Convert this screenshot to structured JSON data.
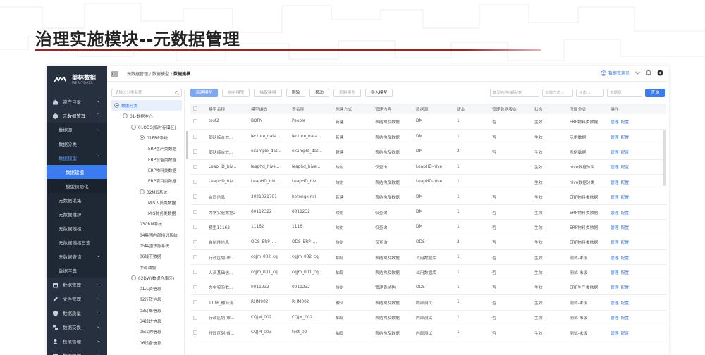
{
  "slide_title": "治理实施模块--元数据管理",
  "logo": {
    "name": "美林数据",
    "sub": "MERITDATA"
  },
  "colors": {
    "accent": "#3b7df0",
    "title_line": "#b01b22",
    "sidebar_bg": "#26303f"
  },
  "sidebar": [
    {
      "label": "资产目录",
      "icon": "home-icon",
      "level": 0,
      "chev": "⌄"
    },
    {
      "label": "元数据管理",
      "icon": "box-icon",
      "level": 0,
      "chev": "⌃",
      "state": "active"
    },
    {
      "label": "数据源",
      "level": 1,
      "chev": "⌄"
    },
    {
      "label": "数据分类",
      "level": 1
    },
    {
      "label": "数据模型",
      "level": 1,
      "chev": "⌃",
      "state": "active-menu"
    },
    {
      "label": "数据建模",
      "level": 2,
      "state": "highlight"
    },
    {
      "label": "模型初始化",
      "level": 2
    },
    {
      "label": "元数据采集",
      "level": 1
    },
    {
      "label": "元数据维护",
      "level": 1
    },
    {
      "label": "元数据稽核",
      "level": 1
    },
    {
      "label": "元数据稽核日志",
      "level": 1
    },
    {
      "label": "元数据查询",
      "level": 1,
      "chev": "⌄"
    },
    {
      "label": "数据字典",
      "level": 1
    },
    {
      "label": "数据管理",
      "icon": "calendar-icon",
      "level": 0,
      "chev": "⌄"
    },
    {
      "label": "文件管理",
      "icon": "pen-icon",
      "level": 0,
      "chev": "⌄"
    },
    {
      "label": "数据质量",
      "icon": "shield-icon",
      "level": 0,
      "chev": "⌄"
    },
    {
      "label": "数据交换",
      "icon": "exchange-icon",
      "level": 0,
      "chev": "⌄"
    },
    {
      "label": "权限管理",
      "icon": "user-icon",
      "level": 0,
      "chev": "⌄"
    },
    {
      "label": "数据地图",
      "icon": "map-icon",
      "level": 0,
      "chev": "⌄"
    }
  ],
  "breadcrumb": [
    "元数据管理",
    "/",
    "数据模型",
    "/",
    "数据建模"
  ],
  "user": {
    "name": "数据管理员",
    "icons": [
      "user-icon",
      "chevron-down-icon",
      "bell-icon",
      "settings-icon"
    ]
  },
  "tree": {
    "search_placeholder": "请输入分类名称",
    "nodes": [
      {
        "label": "数据分类",
        "indent": 0,
        "toggle": true,
        "selected": true
      },
      {
        "label": "01-数据中心",
        "indent": 1,
        "toggle": true
      },
      {
        "label": "01ODS(临时存储区)",
        "indent": 2,
        "toggle": true
      },
      {
        "label": "01ERP系统",
        "indent": 3,
        "toggle": true
      },
      {
        "label": "ERP生产类数据",
        "indent": 4
      },
      {
        "label": "ERP设备类数据",
        "indent": 4
      },
      {
        "label": "ERP物料类数据",
        "indent": 4
      },
      {
        "label": "ERP项目类数据",
        "indent": 4
      },
      {
        "label": "02MIS系统",
        "indent": 3,
        "toggle": true
      },
      {
        "label": "MIS人员类数据",
        "indent": 4
      },
      {
        "label": "MIS财务类数据",
        "indent": 4
      },
      {
        "label": "03CRM系统",
        "indent": 3
      },
      {
        "label": "04集团内部培训系统",
        "indent": 3
      },
      {
        "label": "05集团法务系统",
        "indent": 3
      },
      {
        "label": "06线下数据",
        "indent": 3
      },
      {
        "label": "中海油服",
        "indent": 3
      },
      {
        "label": "02DW(数据仓库区)",
        "indent": 2,
        "toggle": true
      },
      {
        "label": "01人资信息",
        "indent": 3
      },
      {
        "label": "02行政信息",
        "indent": 3
      },
      {
        "label": "03订单信息",
        "indent": 3
      },
      {
        "label": "04设计信息",
        "indent": 3
      },
      {
        "label": "05采购信息",
        "indent": 3
      },
      {
        "label": "06设备信息",
        "indent": 3
      }
    ]
  },
  "toolbar": {
    "buttons": [
      {
        "label": "新建模型",
        "kind": "primary"
      },
      {
        "label": "映射模型",
        "kind": "disabled"
      },
      {
        "label": "抽取建模",
        "kind": "disabled"
      },
      {
        "label": "删除",
        "kind": "enabled"
      },
      {
        "label": "移动",
        "kind": "enabled"
      },
      {
        "label": "复制模型",
        "kind": "disabled"
      },
      {
        "label": "导入模型",
        "kind": "enabled"
      }
    ],
    "filters": [
      "模型名称/编码/表ᵢ",
      "创建方式 ⌄",
      "状态 ⌄",
      "数据源"
    ],
    "search_label": "查询"
  },
  "table": {
    "columns": [
      "",
      "模型名称",
      "模型编码",
      "表名称",
      "创建方式",
      "管理内容",
      "数据源",
      "版本",
      "管理数据版本",
      "状态",
      "所属分类",
      "操作"
    ],
    "rows": [
      [
        "test2",
        "BDPN",
        "People",
        "新建",
        "表结构及数据",
        "DM",
        "1",
        "否",
        "生效",
        "ERP物料类数据"
      ],
      [
        "部队综合效...",
        "lecture_data...",
        "lecture_data...",
        "新建",
        "表结构及数据",
        "DM",
        "1",
        "否",
        "生效",
        "示例数据"
      ],
      [
        "部队综合效...",
        "example_dat...",
        "example_dat...",
        "新建",
        "表结构及数据",
        "DM",
        "2",
        "否",
        "生效",
        "示例数据"
      ],
      [
        "LeapHD_hiv...",
        "leaphd_hive...",
        "leaphd_hive...",
        "映射",
        "仅查询",
        "LeapHD-hive",
        "1",
        "",
        "生效",
        "hive数据分类"
      ],
      [
        "LeapHD_hiv...",
        "LeapHD_hiv...",
        "LeapHD_hiv...",
        "映射",
        "表结构及数据",
        "LeapHD-hive",
        "1",
        "",
        "生效",
        "hive数据分类"
      ],
      [
        "合同信息",
        "2021031701",
        "hetongxinxi",
        "新建",
        "表结构及数据",
        "DM",
        "1",
        "否",
        "生效",
        "ERP物料类数据"
      ],
      [
        "力学实验数据2",
        "00112322",
        "0011232",
        "映射",
        "仅查询",
        "DM",
        "1",
        "否",
        "生效",
        "ERP物料类数据"
      ],
      [
        "模型11162",
        "11162",
        "1116",
        "映射",
        "仅查询",
        "DM",
        "1",
        "否",
        "生效",
        "ERP物料类数据"
      ],
      [
        "自制件信息",
        "ODS_ERP_...",
        "ODS_ERP_...",
        "映射",
        "仅查询",
        "ODS",
        "2",
        "否",
        "生效",
        "ERP物料类数据"
      ],
      [
        "行政区划-市...",
        "cqjm_002_cq",
        "cqjm_002_cq",
        "抽取",
        "表结构及数据",
        "试用数据库",
        "1",
        "否",
        "生效",
        "测试-末级"
      ],
      [
        "人员基础信...",
        "cqjm_001_cq",
        "cqjm_001_cq",
        "抽取",
        "表结构及数据",
        "试用数据库",
        "1",
        "否",
        "生效",
        "测试-末级"
      ],
      [
        "力学实验数...",
        "0011232",
        "0011232",
        "映射",
        "管理表结构",
        "ODS",
        "1",
        "否",
        "生效",
        "ERP生产类数据"
      ],
      [
        "1116_融合测...",
        "RHM002",
        "RHM002",
        "融合",
        "表结构及数据",
        "内部测试",
        "1",
        "否",
        "生效",
        "测试-末级"
      ],
      [
        "行政区划-市...",
        "CQJM_002",
        "CQJM_002",
        "抽取",
        "表结构及数据",
        "内部测试",
        "1",
        "否",
        "生效",
        "测试-末级"
      ],
      [
        "行政区划-省...",
        "CQJM_003",
        "test_02",
        "抽取",
        "表结构及数据",
        "内部测试",
        "1",
        "否",
        "生效",
        "测试-末级"
      ]
    ],
    "actions": [
      "管理",
      "配置"
    ]
  }
}
